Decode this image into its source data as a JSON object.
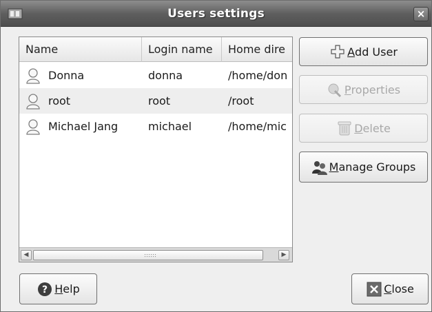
{
  "window": {
    "title": "Users settings",
    "close_glyph": "×"
  },
  "table": {
    "columns": [
      "Name",
      "Login name",
      "Home dire"
    ],
    "rows": [
      {
        "name": "Donna",
        "login": "donna",
        "home": "/home/don"
      },
      {
        "name": "root",
        "login": "root",
        "home": "/root"
      },
      {
        "name": "Michael Jang",
        "login": "michael",
        "home": "/home/mic"
      }
    ]
  },
  "buttons": {
    "add_user": {
      "mnemonic": "A",
      "rest": "dd User",
      "icon": "plus-icon"
    },
    "properties": {
      "mnemonic": "P",
      "rest": "roperties",
      "icon": "properties-icon"
    },
    "delete": {
      "mnemonic": "D",
      "rest": "elete",
      "icon": "trash-icon"
    },
    "manage_groups": {
      "mnemonic": "M",
      "rest": "anage Groups",
      "icon": "group-icon"
    },
    "help": {
      "mnemonic": "H",
      "rest": "elp",
      "icon": "help-icon"
    },
    "close": {
      "mnemonic": "C",
      "rest": "lose",
      "icon": "close-icon"
    }
  },
  "scroll": {
    "left_arrow": "◀",
    "right_arrow": "▶"
  }
}
